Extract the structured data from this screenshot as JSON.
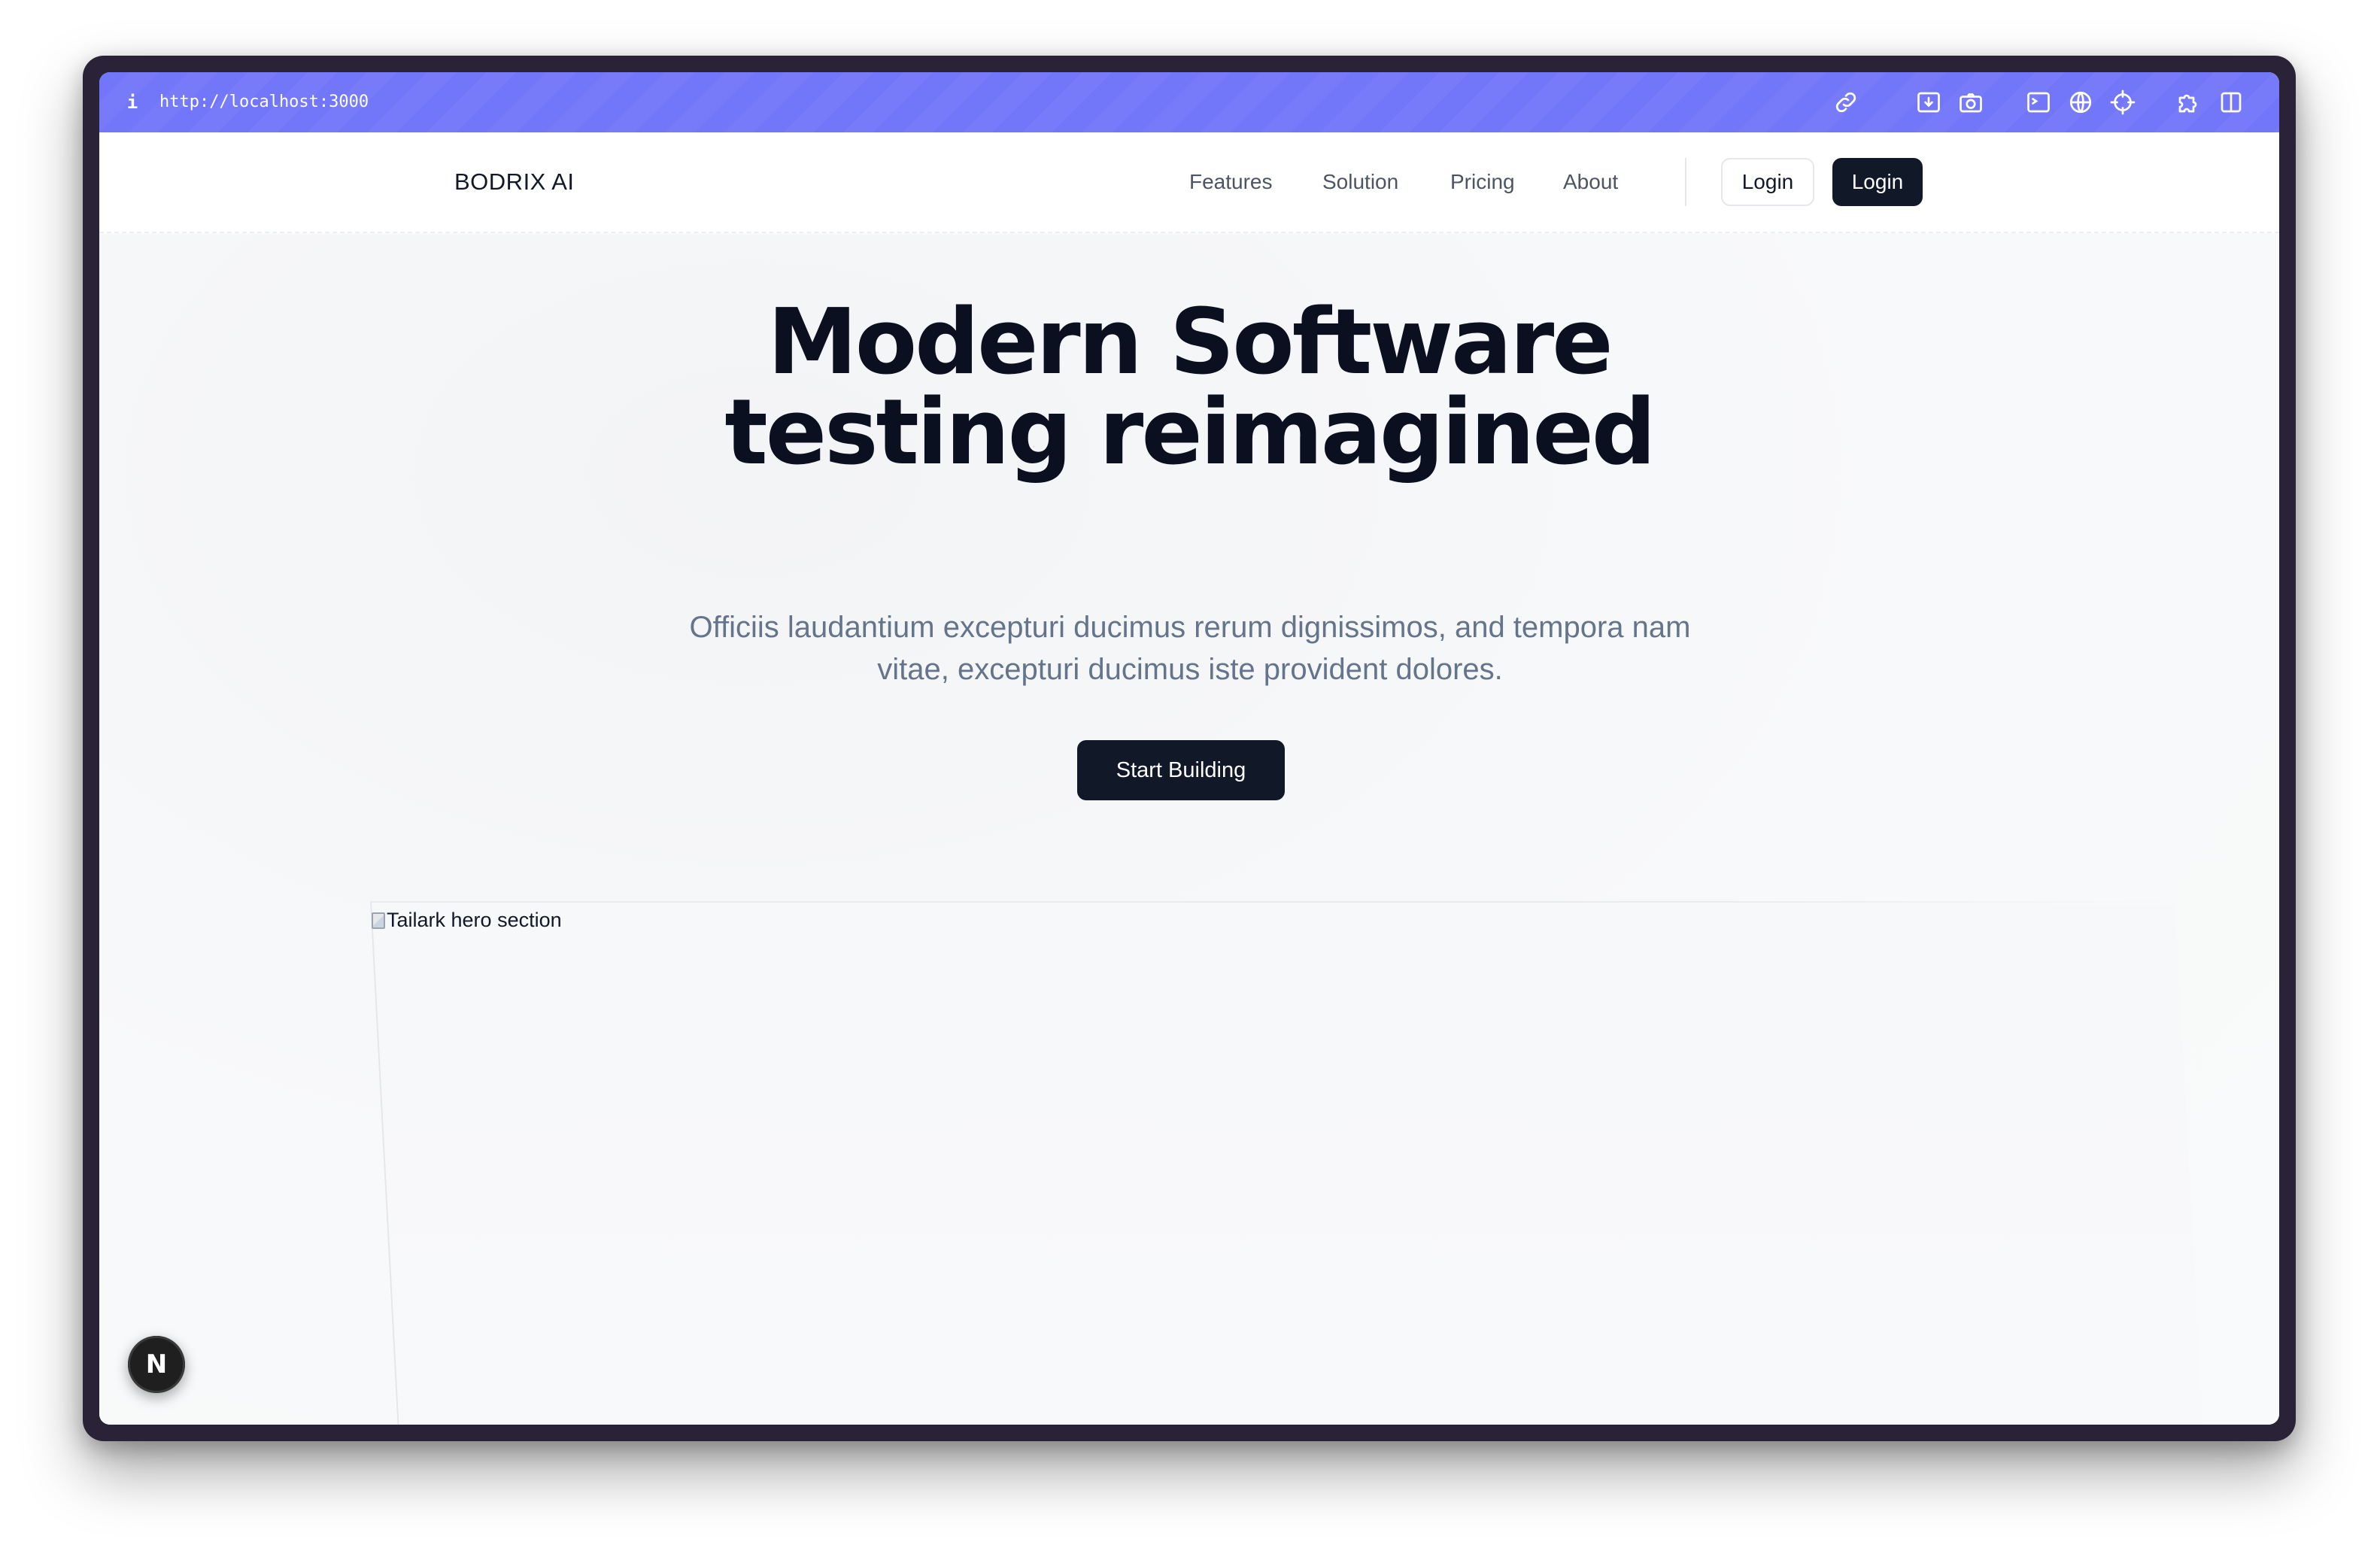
{
  "browser": {
    "url": "http://localhost:3000",
    "info_glyph": "i",
    "accent_color": "#7276f8",
    "toolbar_icons": [
      "link-icon",
      "download-icon",
      "camera-icon",
      "terminal-icon",
      "globe-icon",
      "crosshair-icon",
      "extension-icon",
      "sidebar-icon"
    ]
  },
  "nav": {
    "brand": "BODRIX AI",
    "links": [
      "Features",
      "Solution",
      "Pricing",
      "About"
    ],
    "login_outline": "Login",
    "login_dark": "Login"
  },
  "hero": {
    "title_line1": "Modern Software",
    "title_line2": "testing reimagined",
    "subtitle": "Officiis laudantium excepturi ducimus rerum dignissimos, and tempora nam vitae, excepturi ducimus iste provident dolores.",
    "cta": "Start Building",
    "image_alt": "Tailark hero section"
  },
  "badge": {
    "glyph": "N",
    "icon": "nextjs-icon"
  },
  "colors": {
    "dark": "#111827",
    "muted": "#64748b",
    "background": "#f8f9fa"
  }
}
